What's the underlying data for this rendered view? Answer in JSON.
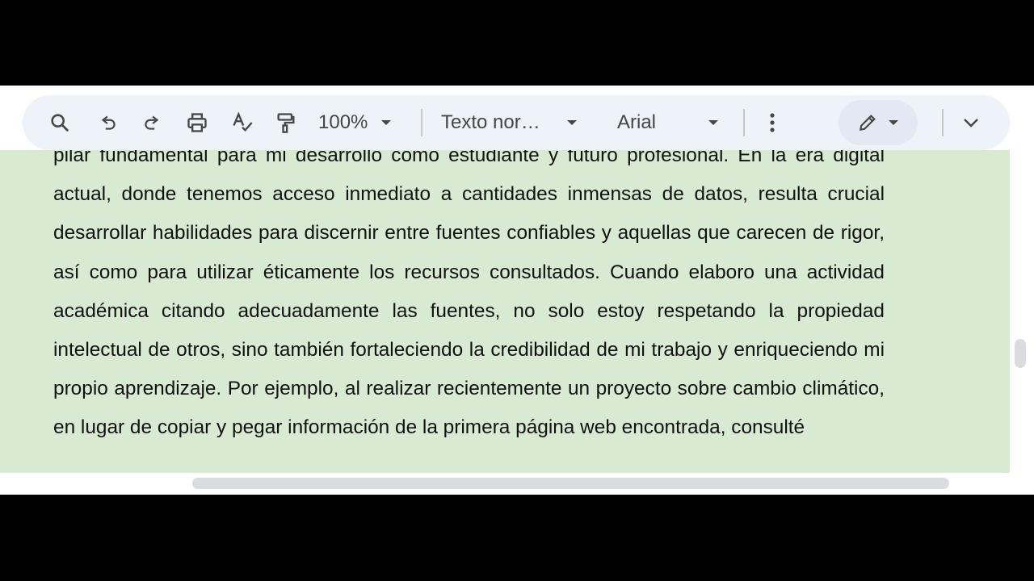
{
  "toolbar": {
    "zoom": "100%",
    "style": "Texto nor…",
    "font": "Arial"
  },
  "document": {
    "text": "pilar fundamental para mi desarrollo como estudiante y futuro profesional. En la era digital actual, donde tenemos acceso inmediato a cantidades inmensas de datos, resulta crucial desarrollar habilidades para discernir entre fuentes confiables y aquellas que carecen de rigor, así como para utilizar éticamente los recursos consultados. Cuando elaboro una actividad académica citando adecuadamente las fuentes, no solo estoy respetando la propiedad intelectual de otros, sino también fortaleciendo la credibilidad de mi trabajo y enriqueciendo mi propio aprendizaje. Por ejemplo, al realizar recientemente un proyecto sobre cambio climático, en lugar de copiar y pegar información de la primera página web encontrada, consulté"
  },
  "colors": {
    "page_background": "#d9ead3",
    "toolbar_background": "#eef2f9",
    "letterbox": "#000000"
  },
  "icons": [
    "search-icon",
    "undo-icon",
    "redo-icon",
    "print-icon",
    "spellcheck-icon",
    "paint-format-icon",
    "chevron-down-icon",
    "more-vert-icon",
    "pencil-icon",
    "expand-icon"
  ]
}
